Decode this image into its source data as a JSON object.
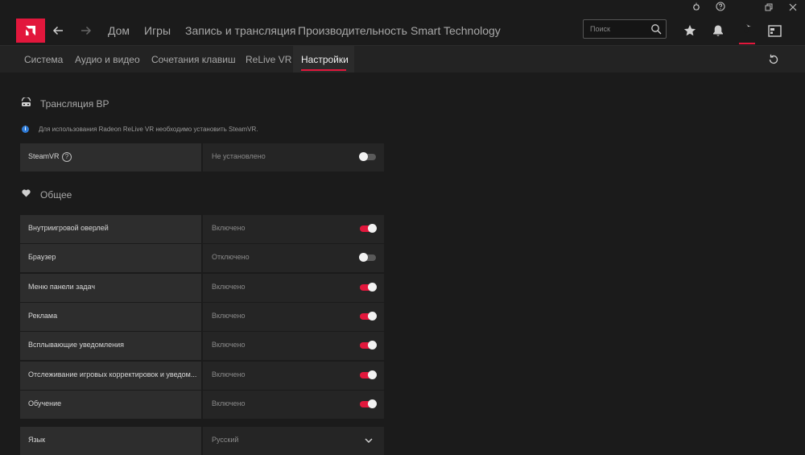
{
  "nav": {
    "items": [
      "Дом",
      "Игры",
      "Запись и трансляция",
      "Производительность",
      "Smart Technology"
    ],
    "search_placeholder": "Поиск"
  },
  "subnav": {
    "items": [
      "Система",
      "Аудио и видео",
      "Сочетания клавиш",
      "ReLive VR",
      "Настройки"
    ],
    "active": "Настройки"
  },
  "vr_section": {
    "title": "Трансляция ВР",
    "note": "Для использования Radeon ReLive VR необходимо установить SteamVR.",
    "steamvr": {
      "label": "SteamVR",
      "value": "Не установлено",
      "enabled": false
    }
  },
  "general": {
    "title": "Общее",
    "rows": [
      {
        "label": "Внутриигровой оверлей",
        "value": "Включено",
        "enabled": true
      },
      {
        "label": "Браузер",
        "value": "Отключено",
        "enabled": false
      },
      {
        "label": "Меню панели задач",
        "value": "Включено",
        "enabled": true
      },
      {
        "label": "Реклама",
        "value": "Включено",
        "enabled": true
      },
      {
        "label": "Всплывающие уведомления",
        "value": "Включено",
        "enabled": true
      },
      {
        "label": "Отслеживание игровых корректировок и уведом...",
        "value": "Включено",
        "enabled": true
      },
      {
        "label": "Обучение",
        "value": "Включено",
        "enabled": true
      }
    ],
    "language": {
      "label": "Язык",
      "value": "Русский"
    }
  },
  "colors": {
    "accent": "#e2173c"
  },
  "icons": [
    "bug-icon",
    "help-icon",
    "restore-icon",
    "close-icon",
    "amd-logo",
    "back-arrow-icon",
    "forward-arrow-icon",
    "search-icon",
    "star-icon",
    "bell-icon",
    "gear-icon",
    "sidebar-icon",
    "reset-icon",
    "vr-icon",
    "info-icon",
    "heart-icon",
    "chevron-down-icon"
  ]
}
